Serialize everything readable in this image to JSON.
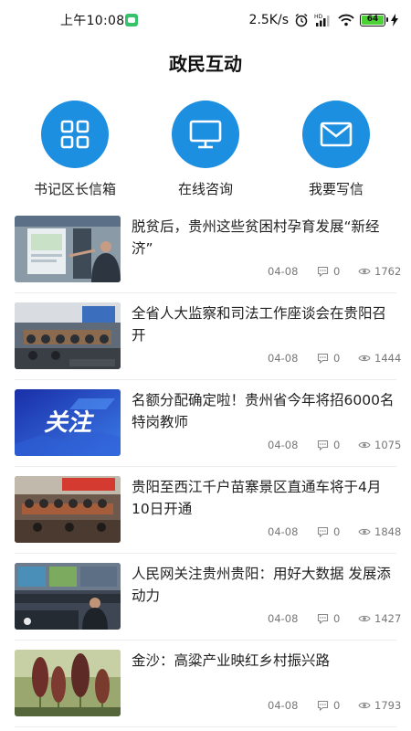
{
  "status_bar": {
    "time": "上午10:08",
    "speed": "2.5K/s",
    "battery": "64"
  },
  "title": "政民互动",
  "quick_actions": [
    {
      "label": "书记区长信箱",
      "icon": "grid-icon"
    },
    {
      "label": "在线咨询",
      "icon": "monitor-icon"
    },
    {
      "label": "我要写信",
      "icon": "mail-icon"
    }
  ],
  "news": [
    {
      "title": "脱贫后，贵州这些贫困村孕育发展“新经济”",
      "date": "04-08",
      "comments": "0",
      "views": "1762"
    },
    {
      "title": "全省人大监察和司法工作座谈会在贵阳召开",
      "date": "04-08",
      "comments": "0",
      "views": "1444"
    },
    {
      "title": "名额分配确定啦！贵州省今年将招6000名特岗教师",
      "date": "04-08",
      "comments": "0",
      "views": "1075",
      "thumb_text": "关注"
    },
    {
      "title": "贵阳至西江千户苗寨景区直通车将于4月10日开通",
      "date": "04-08",
      "comments": "0",
      "views": "1848"
    },
    {
      "title": "人民网关注贵州贵阳：用好大数据 发展添动力",
      "date": "04-08",
      "comments": "0",
      "views": "1427"
    },
    {
      "title": "金沙：高粱产业映红乡村振兴路",
      "date": "04-08",
      "comments": "0",
      "views": "1793"
    }
  ],
  "colors": {
    "accent": "#1d8fe1",
    "battery": "#4cd137",
    "wechat": "#35c26b"
  }
}
